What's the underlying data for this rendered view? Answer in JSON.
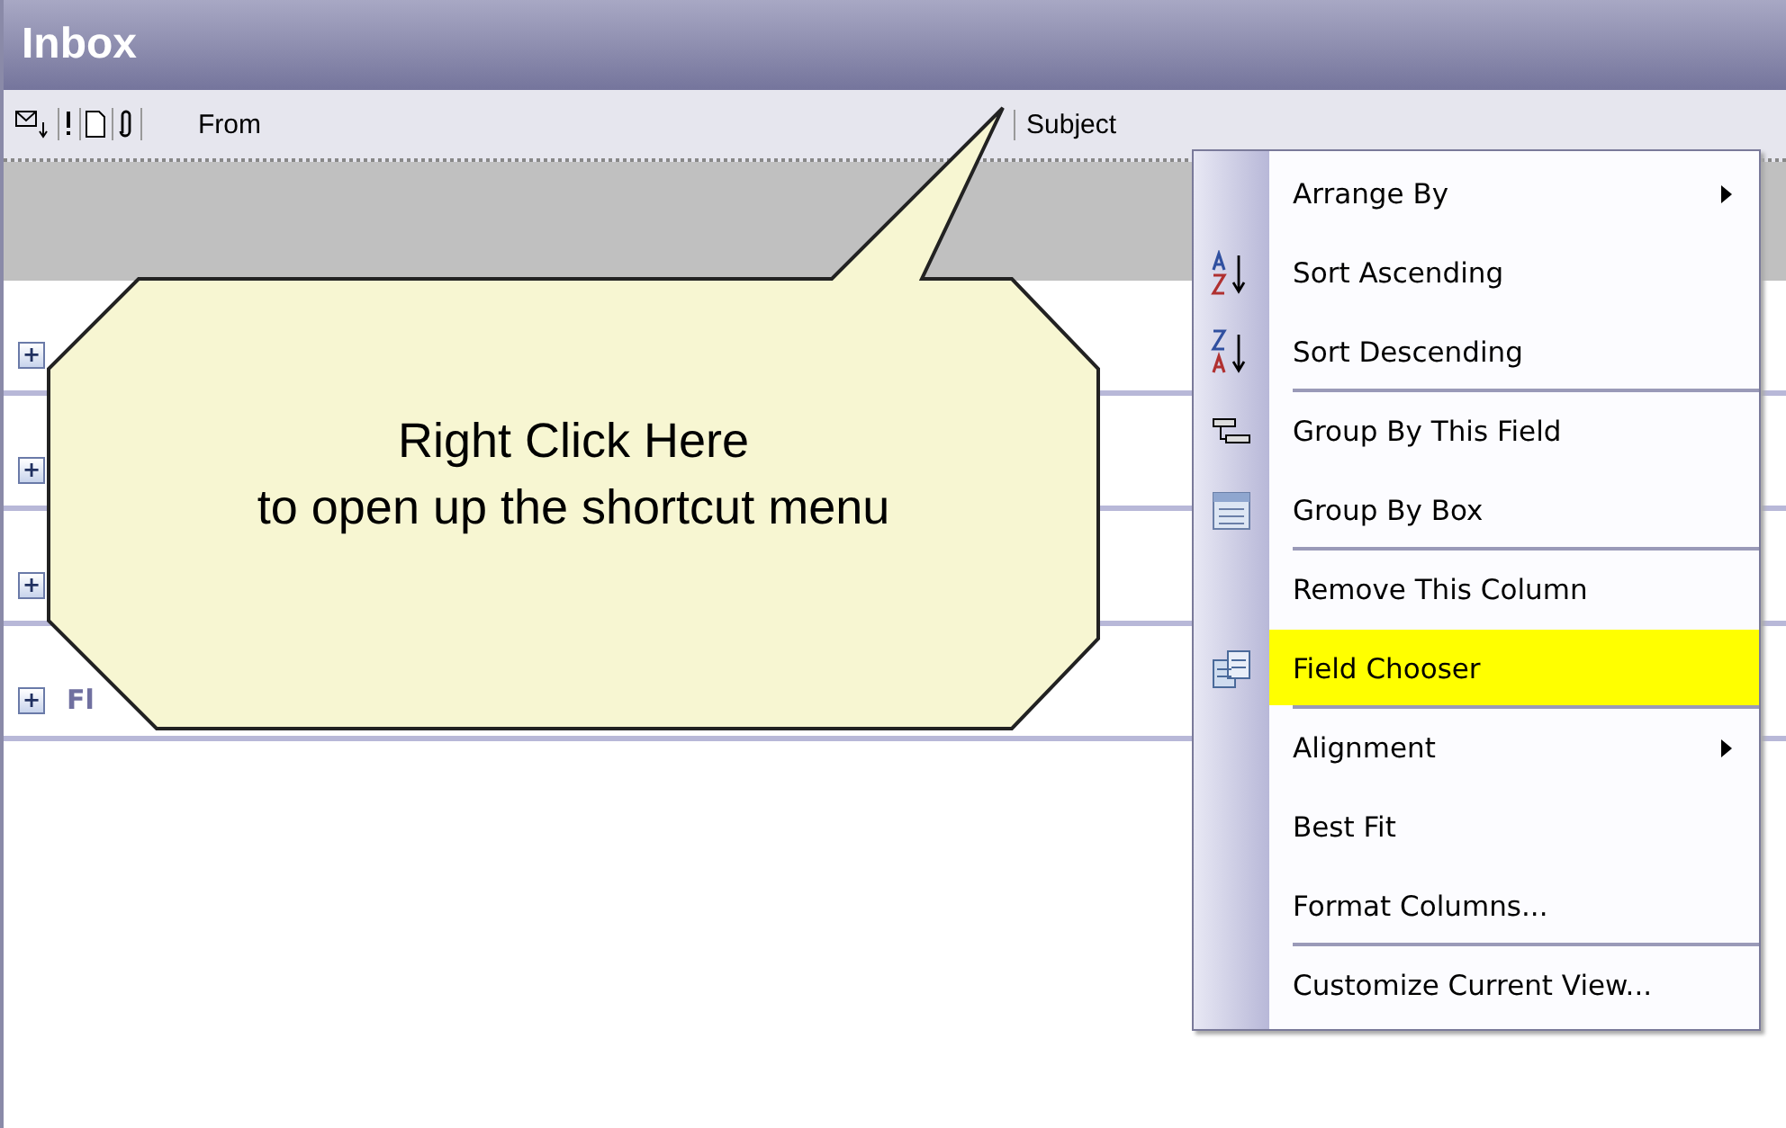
{
  "window": {
    "title": "Inbox"
  },
  "columns": [
    {
      "label": "From"
    },
    {
      "label": "Subject"
    }
  ],
  "groups": [
    {
      "expander": "+"
    },
    {
      "expander": "+"
    },
    {
      "expander": "+"
    },
    {
      "expander": "+",
      "label": "Fl"
    }
  ],
  "callout": {
    "lines": [
      "Right Click Here",
      "to open up the shortcut menu"
    ]
  },
  "menu": [
    {
      "label": "Arrange By",
      "submenu": true,
      "selected": false,
      "separator_after": false
    },
    {
      "label": "Sort Ascending",
      "submenu": false,
      "selected": false,
      "separator_after": false
    },
    {
      "label": "Sort Descending",
      "submenu": false,
      "selected": false,
      "separator_after": true
    },
    {
      "label": "Group By This Field",
      "submenu": false,
      "selected": false,
      "separator_after": false
    },
    {
      "label": "Group By Box",
      "submenu": false,
      "selected": false,
      "separator_after": true
    },
    {
      "label": "Remove This Column",
      "submenu": false,
      "selected": false,
      "separator_after": false
    },
    {
      "label": "Field Chooser",
      "submenu": false,
      "selected": true,
      "separator_after": true
    },
    {
      "label": "Alignment",
      "submenu": true,
      "selected": false,
      "separator_after": false
    },
    {
      "label": "Best Fit",
      "submenu": false,
      "selected": false,
      "separator_after": false
    },
    {
      "label": "Format Columns...",
      "submenu": false,
      "selected": false,
      "separator_after": true
    },
    {
      "label": "Customize Current View...",
      "submenu": false,
      "selected": false,
      "separator_after": false
    }
  ]
}
